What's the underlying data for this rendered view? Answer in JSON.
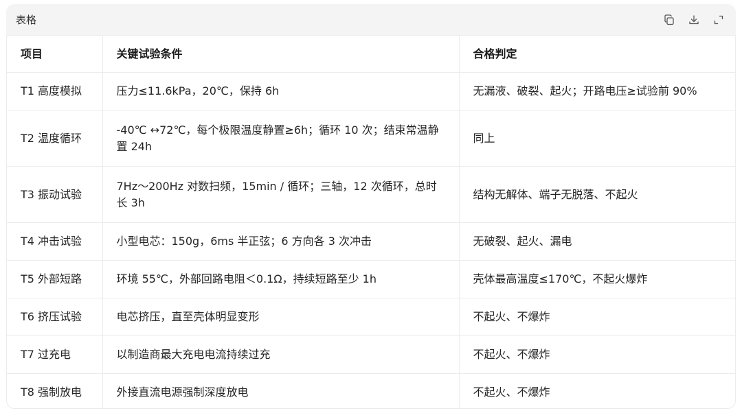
{
  "card": {
    "title": "表格",
    "toolbar": {
      "copy_icon": "copy-icon",
      "download_icon": "download-icon",
      "expand_icon": "expand-icon"
    }
  },
  "table": {
    "headers": [
      "项目",
      "关键试验条件",
      "合格判定"
    ],
    "rows": [
      {
        "item": "T1 高度模拟",
        "condition": "压力≤11.6kPa，20℃，保持 6h",
        "criteria": "无漏液、破裂、起火；开路电压≥试验前 90%"
      },
      {
        "item": "T2 温度循环",
        "condition": "-40℃ ↔72℃，每个极限温度静置≥6h；循环 10 次；结束常温静置 24h",
        "criteria": "同上"
      },
      {
        "item": "T3 振动试验",
        "condition": "7Hz～200Hz 对数扫频，15min / 循环；三轴，12 次循环，总时长 3h",
        "criteria": "结构无解体、端子无脱落、不起火"
      },
      {
        "item": "T4 冲击试验",
        "condition": "小型电芯：150g，6ms 半正弦；6 方向各 3 次冲击",
        "criteria": "无破裂、起火、漏电"
      },
      {
        "item": "T5 外部短路",
        "condition": "环境 55℃，外部回路电阻＜0.1Ω，持续短路至少 1h",
        "criteria": "壳体最高温度≤170℃，不起火爆炸"
      },
      {
        "item": "T6 挤压试验",
        "condition": "电芯挤压，直至壳体明显变形",
        "criteria": "不起火、不爆炸"
      },
      {
        "item": "T7 过充电",
        "condition": "以制造商最大充电电流持续过充",
        "criteria": "不起火、不爆炸"
      },
      {
        "item": "T8 强制放电",
        "condition": "外接直流电源强制深度放电",
        "criteria": "不起火、不爆炸"
      }
    ]
  }
}
